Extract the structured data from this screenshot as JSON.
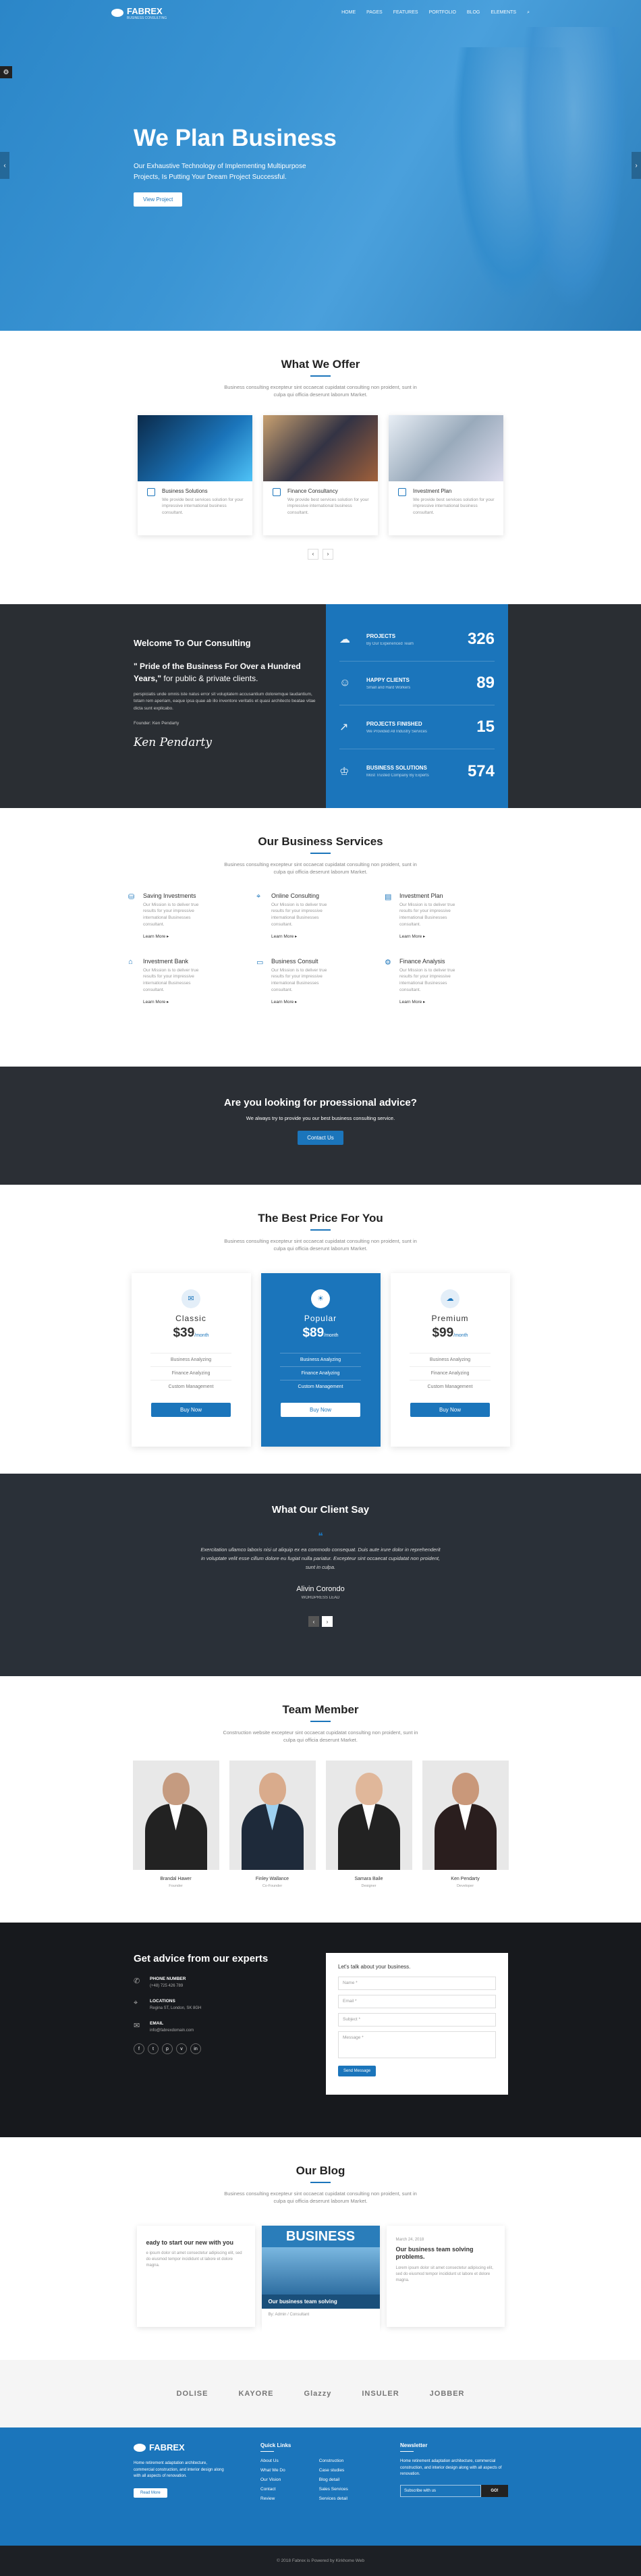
{
  "nav": {
    "brand": "FABREX",
    "tagline": "BUSINESS CONSULTING",
    "items": [
      "HOME",
      "PAGES",
      "FEATURES",
      "PORTFOLIO",
      "BLOG",
      "ELEMENTS"
    ]
  },
  "hero": {
    "title": "We Plan Business",
    "text": "Our Exhaustive Technology of Implementing Multipurpose Projects, Is Putting Your Dream Project Successful.",
    "button": "View Project"
  },
  "offer": {
    "title": "What We Offer",
    "subtitle": "Business consulting excepteur sint occaecat cupidatat consulting non proident, sunt in culpa qui officia deserunt laborum Market.",
    "cards": [
      {
        "title": "Business Solutions",
        "text": "We provide best services solution for your impressive international business consultant."
      },
      {
        "title": "Finance Consultancy",
        "text": "We provide best services solution for your impressive international business consultant."
      },
      {
        "title": "Investment Plan",
        "text": "We provide best services solution for your impressive international business consultant."
      }
    ]
  },
  "welcome": {
    "title": "Welcome To Our Consulting",
    "quote_bold": "\" Pride of the Business For Over a Hundred Years,\"",
    "quote_rest": " for public & private clients.",
    "text": "perspiciatis unde omnis iste natus error sit voluptatem accusantium doloremque laudantium, totam rem aperiam, eaque ipsa quae ab illo inventore veritatis et quasi architecto beatae vitae dicta sunt explicabo.",
    "founder": "Founder: Ken Pendarty",
    "signature": "Ken Pendarty",
    "stats": [
      {
        "label": "PROJECTS",
        "sub": "By Our Experienced Team",
        "value": "326"
      },
      {
        "label": "HAPPY CLIENTS",
        "sub": "Small and Hard Workers",
        "value": "89"
      },
      {
        "label": "PROJECTS FINISHED",
        "sub": "We Provided All Industry Services",
        "value": "15"
      },
      {
        "label": "BUSINESS SOLUTIONS",
        "sub": "Most Trusted Company By Experts",
        "value": "574"
      }
    ]
  },
  "services": {
    "title": "Our Business Services",
    "subtitle": "Business consulting excepteur sint occaecat cupidatat consulting non proident, sunt in culpa qui officia deserunt laborum Market.",
    "items": [
      {
        "title": "Saving Investments",
        "text": "Our Mission is to deliver true results for your impressive international Businesses consultant.",
        "link": "Learn More ▸"
      },
      {
        "title": "Online Consulting",
        "text": "Our Mission is to deliver true results for your impressive international Businesses consultant.",
        "link": "Learn More ▸"
      },
      {
        "title": "Investment Plan",
        "text": "Our Mission is to deliver true results for your impressive international Businesses consultant.",
        "link": "Learn More ▸"
      },
      {
        "title": "Investment Bank",
        "text": "Our Mission is to deliver true results for your impressive international Businesses consultant.",
        "link": "Learn More ▸"
      },
      {
        "title": "Business Consult",
        "text": "Our Mission is to deliver true results for your impressive international Businesses consultant.",
        "link": "Learn More ▸"
      },
      {
        "title": "Finance Analysis",
        "text": "Our Mission is to deliver true results for your impressive international Businesses consultant.",
        "link": "Learn More ▸"
      }
    ]
  },
  "advice": {
    "title": "Are you looking for proessional advice?",
    "text": "We always try to provide you our best business consulting service.",
    "button": "Contact Us"
  },
  "pricing": {
    "title": "The Best Price For You",
    "subtitle": "Business consulting excepteur sint occaecat cupidatat consulting non proident, sunt in culpa qui officia deserunt laborum Market.",
    "plans": [
      {
        "name": "Classic",
        "price": "$39",
        "per": "/month",
        "features": [
          "Business Analyzing",
          "Finance Analyzing",
          "Custom Management"
        ],
        "button": "Buy Now"
      },
      {
        "name": "Popular",
        "price": "$89",
        "per": "/month",
        "features": [
          "Business Analyzing",
          "Finance Analyzing",
          "Custom Management"
        ],
        "button": "Buy Now"
      },
      {
        "name": "Premium",
        "price": "$99",
        "per": "/month",
        "features": [
          "Business Analyzing",
          "Finance Analyzing",
          "Custom Management"
        ],
        "button": "Buy Now"
      }
    ]
  },
  "testimonial": {
    "title": "What Our Client Say",
    "text": "Exercitation ullamco laboris nisi ut aliquip ex ea commodo consequat. Duis aute irure dolor in reprehenderit in voluptate velit esse cillum dolore eu fugiat nulla pariatur. Excepteur sint occaecat cupidatat non proident, sunt in culpa.",
    "name": "Alivin Corondo",
    "role": "WORDPRESS LEAD"
  },
  "team": {
    "title": "Team Member",
    "subtitle": "Construction website excepteur sint occaecat cupidatat consulting non proident, sunt in culpa qui officia deserunt Market.",
    "members": [
      {
        "name": "Brandal Hawer",
        "role": "Founder"
      },
      {
        "name": "Finley Wallance",
        "role": "Co-Founder"
      },
      {
        "name": "Samara Baile",
        "role": "Designer"
      },
      {
        "name": "Ken Pendarty",
        "role": "Developer"
      }
    ]
  },
  "contact": {
    "title": "Get advice from our experts",
    "phone_label": "PHONE NUMBER",
    "phone": "(+48) 725 426 789",
    "location_label": "LOCATIONS",
    "location": "Regina ST, London, SK 8GH",
    "email_label": "EMAIL",
    "email": "info@fabrexdomain.com",
    "form_title": "Let's talk about your business.",
    "fields": [
      "Name *",
      "Email *",
      "Subject *",
      "Message *"
    ],
    "submit": "Send Message"
  },
  "blog": {
    "title": "Our Blog",
    "subtitle": "Business consulting excepteur sint occaecat cupidatat consulting non proident, sunt in culpa qui officia deserunt laborum Market.",
    "left_title": "eady to start our new with you",
    "left_text": "e ipsum dolor sit amet consectetur adipiscing elit, sed do eiusmod tempor incididunt ut labore et dolore magna.",
    "mid_banner": "BUSINESS",
    "mid_caption": "Our business team solving",
    "mid_meta": "By: Admin / Consultant",
    "right_date": "March 24, 2018",
    "right_title": "Our business team solving problems.",
    "right_text": "Lorem ipsum dolor sit amet consectetur adipiscing elit, sed do eiusmod tempor incididunt ut labore et dolore magna."
  },
  "brands": [
    "DOLISE",
    "KAYORE",
    "Glazzy",
    "INSULER",
    "JOBBER"
  ],
  "footer": {
    "brand": "FABREX",
    "text": "Home retirement adaptation architecture, commercial construction, and interior design along with all aspects of renovation.",
    "button": "Read More",
    "links_title": "Quick Links",
    "links1": [
      "About Us",
      "What We Do",
      "Our Vision",
      "Contact",
      "Review"
    ],
    "links2": [
      "Construction",
      "Case studies",
      "Blog detail",
      "Sales Services",
      "Services detail"
    ],
    "news_title": "Newsletter",
    "news_text": "Home retirement adaptation architecture, commercial construction, and interior design along with all aspects of renovation.",
    "news_placeholder": "Subscribe with us",
    "news_button": "GO!",
    "copyright": "© 2018 Fabrex is Powered by Kirkhome Web"
  }
}
